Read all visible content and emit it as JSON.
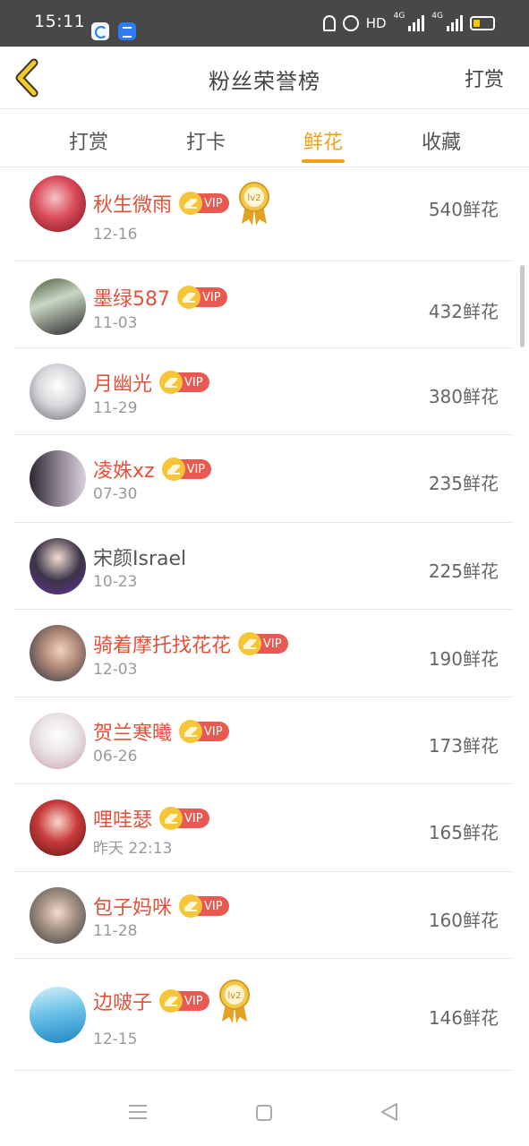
{
  "status_bar": {
    "time": "15:11",
    "network_type": "HD",
    "signal1_label": "4G",
    "signal2_label": "4G",
    "icons": [
      "notifications-off-icon",
      "alarm-icon",
      "signal-icon",
      "battery-icon"
    ],
    "battery_level": 0.25
  },
  "header": {
    "title": "粉丝荣誉榜",
    "action_label": "打赏",
    "back_icon": "chevron-left-icon"
  },
  "tabs": [
    {
      "label": "打赏",
      "active": false
    },
    {
      "label": "打卡",
      "active": false
    },
    {
      "label": "鲜花",
      "active": true
    },
    {
      "label": "收藏",
      "active": false
    }
  ],
  "accent_color": "#f0a11c",
  "list": [
    {
      "name": "秋生微雨",
      "vip": true,
      "vip_label": "VIP",
      "medal": "lv2",
      "date": "12-16",
      "amount": "540鲜花"
    },
    {
      "name": "墨绿587",
      "vip": true,
      "vip_label": "VIP",
      "date": "11-03",
      "amount": "432鲜花"
    },
    {
      "name": "月幽光",
      "vip": true,
      "vip_label": "VIP",
      "date": "11-29",
      "amount": "380鲜花"
    },
    {
      "name": "凌姝xz",
      "vip": true,
      "vip_label": "VIP",
      "date": "07-30",
      "amount": "235鲜花"
    },
    {
      "name": "宋颜Israel",
      "vip": false,
      "date": "10-23",
      "amount": "225鲜花"
    },
    {
      "name": "骑着摩托找花花",
      "vip": true,
      "vip_label": "VIP",
      "date": "12-03",
      "amount": "190鲜花"
    },
    {
      "name": "贺兰寒曦",
      "vip": true,
      "vip_label": "VIP",
      "date": "06-26",
      "amount": "173鲜花"
    },
    {
      "name": "哩哇瑟",
      "vip": true,
      "vip_label": "VIP",
      "date": "昨天 22:13",
      "amount": "165鲜花"
    },
    {
      "name": "包子妈咪",
      "vip": true,
      "vip_label": "VIP",
      "date": "11-28",
      "amount": "160鲜花"
    },
    {
      "name": "边啵子",
      "vip": true,
      "vip_label": "VIP",
      "medal": "lv2",
      "date": "12-15",
      "amount": "146鲜花"
    }
  ],
  "nav_bar": {
    "icons": [
      "menu-icon",
      "home-icon",
      "back-icon"
    ]
  }
}
